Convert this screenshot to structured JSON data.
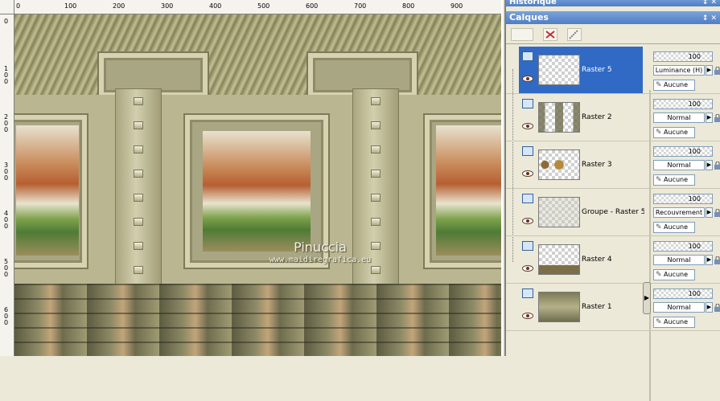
{
  "rulers": {
    "top_ticks": [
      "0",
      "100",
      "200",
      "300",
      "400",
      "500",
      "600",
      "700",
      "800",
      "900"
    ],
    "left_ticks": [
      "0",
      "1 0 0",
      "2 0 0",
      "3 0 0",
      "4 0 0",
      "5 0 0",
      "6 0 0"
    ]
  },
  "watermark": {
    "name": "Pinuccia",
    "url": "www.maidiregrafica.eu"
  },
  "panel": {
    "history_title": "Historique",
    "layers_title": "Calques",
    "title_icons": "↕ ✕"
  },
  "layers": [
    {
      "name": "Raster 5",
      "opacity": "100",
      "blend": "Luminance (H)",
      "mask": "Aucune",
      "selected": true
    },
    {
      "name": "Raster 2",
      "opacity": "100",
      "blend": "Normal",
      "mask": "Aucune",
      "selected": false
    },
    {
      "name": "Raster 3",
      "opacity": "100",
      "blend": "Normal",
      "mask": "Aucune",
      "selected": false
    },
    {
      "name": "Groupe - Raster 5",
      "opacity": "100",
      "blend": "Recouvrement",
      "mask": "Aucune",
      "selected": false
    },
    {
      "name": "Raster 4",
      "opacity": "100",
      "blend": "Normal",
      "mask": "Aucune",
      "selected": false
    },
    {
      "name": "Raster 1",
      "opacity": "100",
      "blend": "Normal",
      "mask": "Aucune",
      "selected": false
    }
  ],
  "colors": {
    "selected": "#316ac5",
    "titlebar": "#4f7ec6",
    "panel_bg": "#ece9d8"
  }
}
